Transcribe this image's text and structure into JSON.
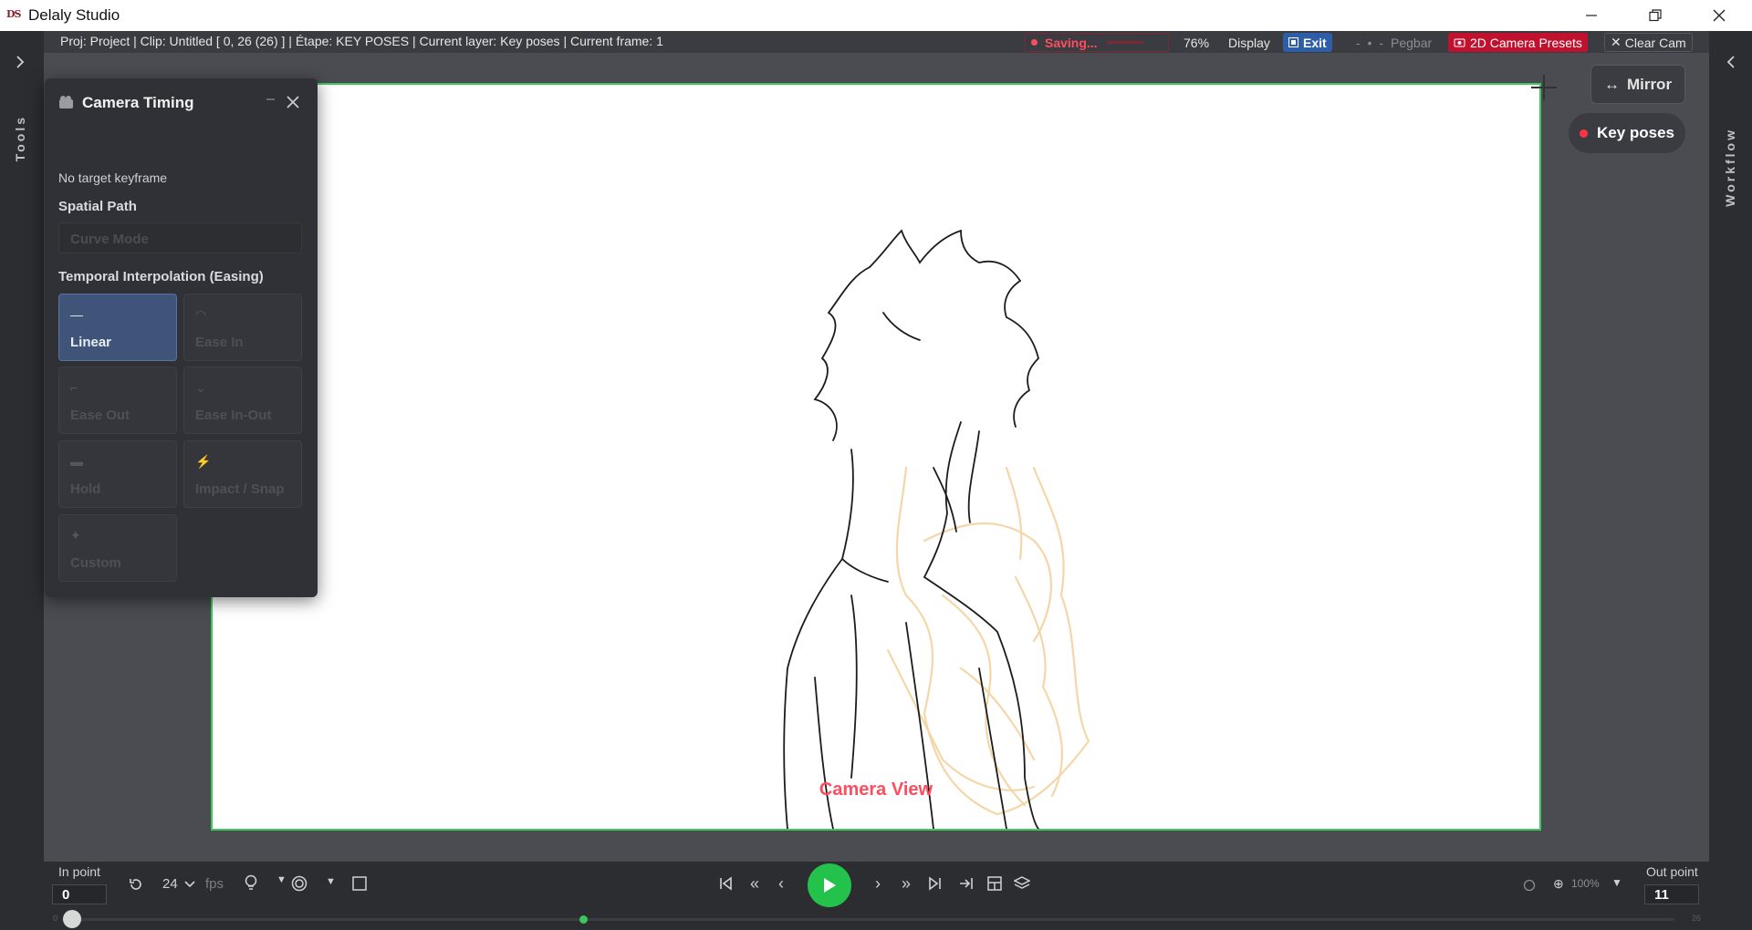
{
  "app": {
    "logo": "DS",
    "title": "Delaly Studio"
  },
  "infobar": {
    "status": "Proj: Project | Clip: Untitled [ 0, 26 (26) ] | Étape: KEY POSES | Current layer: Key poses | Current frame: 1",
    "saving": "Saving...",
    "zoom": "76%",
    "display": "Display",
    "exit": "Exit",
    "pegbar": "Pegbar",
    "camera_presets": "2D Camera Presets",
    "clear_cam": "Clear Cam"
  },
  "side": {
    "tools_label": "Tools",
    "workflow_label": "Workflow"
  },
  "overlay": {
    "mirror": "Mirror",
    "key_poses": "Key poses",
    "camera_view": "Camera View"
  },
  "panel": {
    "title": "Camera Timing",
    "no_target": "No target keyframe",
    "spatial_heading": "Spatial Path",
    "curve_mode_placeholder": "Curve Mode",
    "temporal_heading": "Temporal Interpolation (Easing)",
    "easing": [
      {
        "label": "Linear",
        "icon": "—",
        "active": true
      },
      {
        "label": "Ease In",
        "icon": "◠",
        "active": false
      },
      {
        "label": "Ease Out",
        "icon": "⌐",
        "active": false
      },
      {
        "label": "Ease In-Out",
        "icon": "⌄",
        "active": false
      },
      {
        "label": "Hold",
        "icon": "▬",
        "active": false
      },
      {
        "label": "Impact / Snap",
        "icon": "⚡",
        "active": false
      },
      {
        "label": "Custom",
        "icon": "✦",
        "active": false
      }
    ]
  },
  "bottom": {
    "in_point_label": "In point",
    "in_point_value": "0",
    "fps_value": "24",
    "fps_label": "fps",
    "out_point_label": "Out point",
    "out_point_value": "11",
    "zoom_value": "100%",
    "timeline_start": "0",
    "timeline_end": "26"
  },
  "colors": {
    "accent_green": "#3cc75a",
    "saving_red": "#ff4d5e",
    "presets_bg": "#c0112f",
    "exit_bg": "#2f5ea8",
    "active_card": "#3f5478"
  }
}
